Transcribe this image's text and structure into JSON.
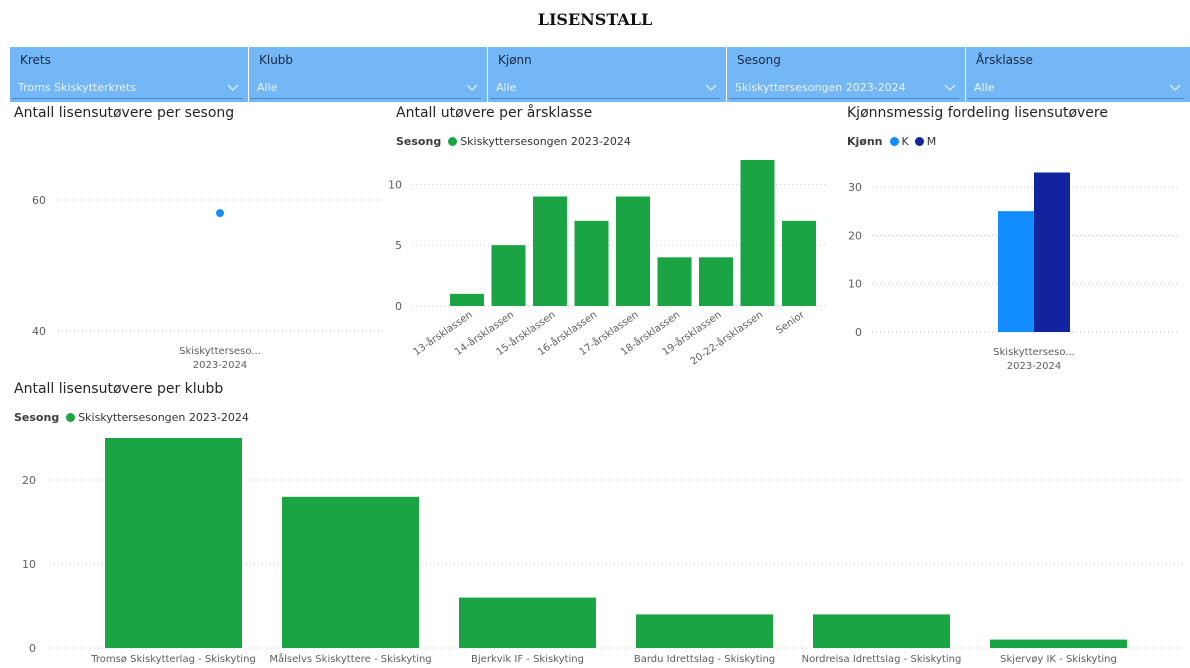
{
  "page": {
    "title": "LISENSTALL"
  },
  "slicers": [
    {
      "label": "Krets",
      "value": "Troms Skiskytterkrets"
    },
    {
      "label": "Klubb",
      "value": "Alle"
    },
    {
      "label": "Kjønn",
      "value": "Alle"
    },
    {
      "label": "Sesong",
      "value": "Skiskyttersesongen 2023-2024"
    },
    {
      "label": "Årsklasse",
      "value": "Alle"
    }
  ],
  "colors": {
    "slicer_bg": "#73b7f7",
    "green": "#1aa443",
    "blue_light": "#118dff",
    "navy": "#12239e",
    "dot": "#118dff"
  },
  "chart_data": [
    {
      "type": "scatter",
      "title": "Antall lisensutøvere per sesong",
      "categories": [
        "Skiskytterseso... 2023-2024"
      ],
      "values": [
        58
      ],
      "y_ticks": [
        40,
        60
      ],
      "ylim": [
        38,
        62
      ],
      "grid": true
    },
    {
      "type": "bar",
      "title": "Antall utøvere per årsklasse",
      "legend_title": "Sesong",
      "series": [
        {
          "name": "Skiskyttersesongen 2023-2024",
          "color": "#1aa443",
          "values": [
            1,
            5,
            9,
            7,
            9,
            4,
            4,
            12,
            7
          ]
        }
      ],
      "categories": [
        "13-årsklassen",
        "14-årsklassen",
        "15-årsklassen",
        "16-årsklassen",
        "17-årsklassen",
        "18-årsklassen",
        "19-årsklassen",
        "20-22-årsklassen",
        "Senior"
      ],
      "y_ticks": [
        0,
        5,
        10
      ],
      "ylim": [
        0,
        12
      ],
      "grid": true,
      "legend_position": "top-left"
    },
    {
      "type": "bar",
      "title": "Kjønnsmessig fordeling lisensutøvere",
      "legend_title": "Kjønn",
      "categories": [
        "Skiskytterseso... 2023-2024"
      ],
      "series": [
        {
          "name": "K",
          "color": "#118dff",
          "values": [
            25
          ]
        },
        {
          "name": "M",
          "color": "#12239e",
          "values": [
            33
          ]
        }
      ],
      "y_ticks": [
        0,
        10,
        20,
        30
      ],
      "ylim": [
        0,
        33
      ],
      "grid": true,
      "legend_position": "top-left"
    },
    {
      "type": "bar",
      "title": "Antall lisensutøvere per klubb",
      "legend_title": "Sesong",
      "series": [
        {
          "name": "Skiskyttersesongen 2023-2024",
          "color": "#1aa443",
          "values": [
            25,
            18,
            6,
            4,
            4,
            1
          ]
        }
      ],
      "categories": [
        "Tromsø Skiskytterlag - Skiskyting",
        "Målselvs Skiskyttere - Skiskyting",
        "Bjerkvik IF - Skiskyting",
        "Bardu Idrettslag - Skiskyting",
        "Nordreisa Idrettslag - Skiskyting",
        "Skjervøy IK - Skiskyting"
      ],
      "y_ticks": [
        0,
        10,
        20
      ],
      "ylim": [
        0,
        25
      ],
      "grid": true,
      "legend_position": "top-left"
    }
  ]
}
